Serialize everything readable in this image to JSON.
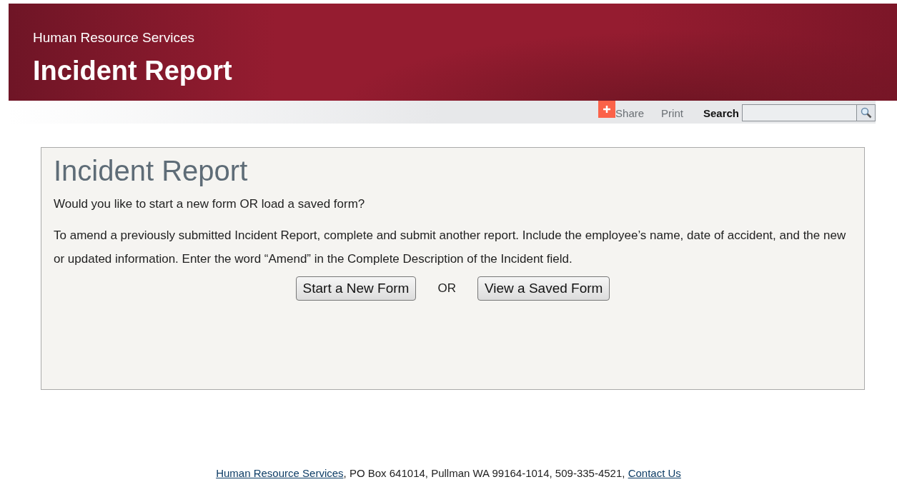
{
  "header": {
    "subtitle": "Human Resource Services",
    "title": "Incident Report"
  },
  "toolbar": {
    "share": "Share",
    "print": "Print",
    "search_label": "Search"
  },
  "panel": {
    "heading": "Incident Report",
    "question": "Would you like to start a new form OR load a saved form?",
    "instructions": "To amend a previously submitted Incident Report, complete and submit another report. Include the employee’s name, date of accident, and the new or updated information. Enter the word “Amend” in the Complete Description of the Incident field.",
    "new_button": "Start a New Form",
    "separator": "OR",
    "saved_button": "View a Saved Form"
  },
  "footer": {
    "link": "Human Resource Services",
    "text": ", PO Box 641014, Pullman WA 99164-1014, 509-335-4521, ",
    "contact_link": "Contact Us"
  }
}
